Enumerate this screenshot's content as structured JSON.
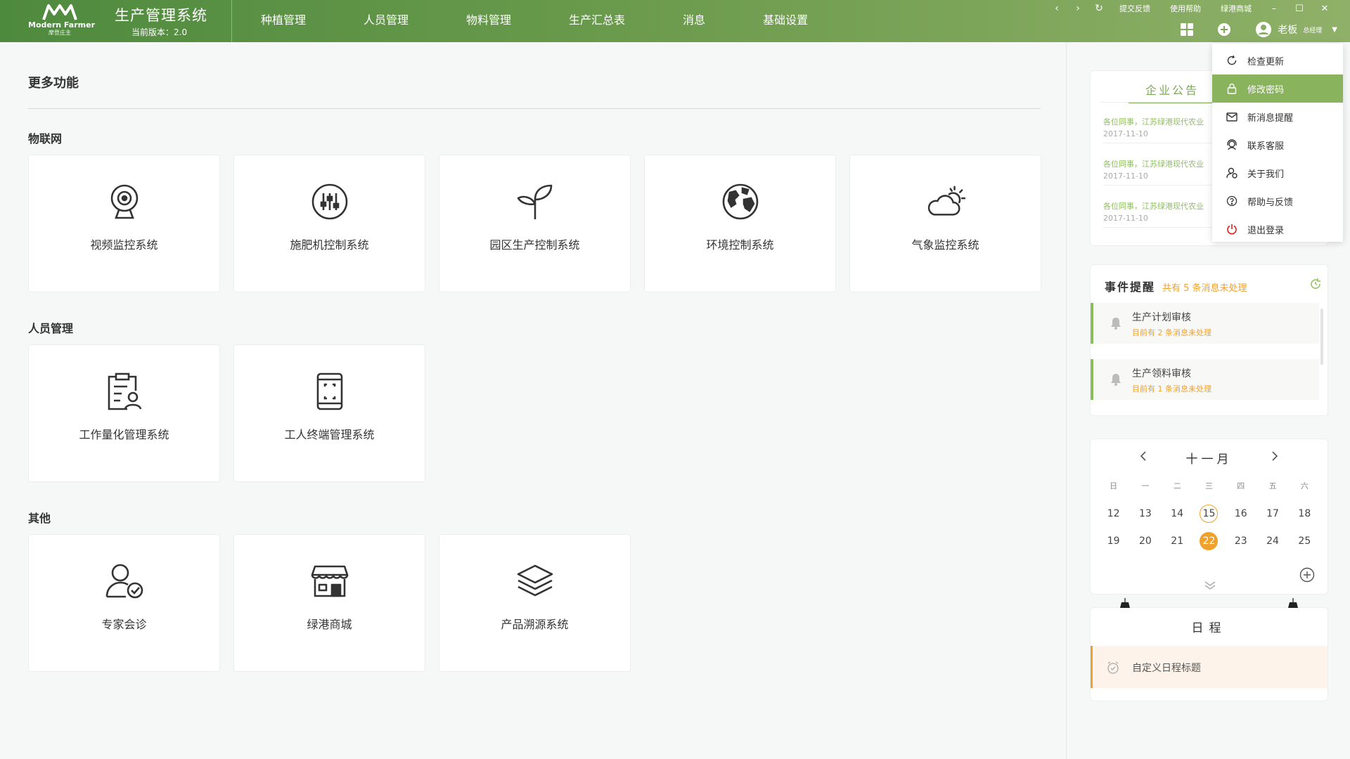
{
  "brand": {
    "logo_en": "Modern Farmer",
    "logo_cn": "摩登庄主",
    "app_title": "生产管理系统",
    "version": "当前版本：2.0"
  },
  "nav": [
    {
      "label": "种植管理"
    },
    {
      "label": "人员管理"
    },
    {
      "label": "物料管理"
    },
    {
      "label": "生产汇总表"
    },
    {
      "label": "消息"
    },
    {
      "label": "基础设置"
    }
  ],
  "toplinks": {
    "feedback": "提交反馈",
    "help": "使用帮助",
    "mall": "绿港商城"
  },
  "user": {
    "name": "老板",
    "role": "总经理"
  },
  "main": {
    "title": "更多功能",
    "sections": [
      {
        "title": "物联网",
        "cards": [
          {
            "label": "视频监控系统",
            "icon": "webcam-icon"
          },
          {
            "label": "施肥机控制系统",
            "icon": "sliders-icon"
          },
          {
            "label": "园区生产控制系统",
            "icon": "sprout-icon"
          },
          {
            "label": "环境控制系统",
            "icon": "globe-icon"
          },
          {
            "label": "气象监控系统",
            "icon": "weather-icon"
          }
        ]
      },
      {
        "title": "人员管理",
        "cards": [
          {
            "label": "工作量化管理系统",
            "icon": "clipboard-user-icon"
          },
          {
            "label": "工人终端管理系统",
            "icon": "mobile-terminal-icon"
          }
        ]
      },
      {
        "title": "其他",
        "cards": [
          {
            "label": "专家会诊",
            "icon": "expert-check-icon"
          },
          {
            "label": "绿港商城",
            "icon": "store-icon"
          },
          {
            "label": "产品溯源系统",
            "icon": "layers-icon"
          }
        ]
      }
    ]
  },
  "notice": {
    "tab": "企业公告",
    "items": [
      {
        "text": "各位同事，江苏绿港现代农业",
        "date": "2017-11-10"
      },
      {
        "text": "各位同事，江苏绿港现代农业",
        "date": "2017-11-10"
      },
      {
        "text": "各位同事，江苏绿港现代农业",
        "date": "2017-11-10"
      }
    ]
  },
  "events": {
    "title": "事件提醒",
    "subtitle": "共有 5 条消息未处理",
    "items": [
      {
        "title": "生产计划审核",
        "sub": "目前有  2  条消息未处理"
      },
      {
        "title": "生产领料审核",
        "sub": "目前有  1  条消息未处理"
      }
    ]
  },
  "calendar": {
    "month": "十一月",
    "weekdays": [
      "日",
      "一",
      "二",
      "三",
      "四",
      "五",
      "六"
    ],
    "week1": [
      "12",
      "13",
      "14",
      "15",
      "16",
      "17",
      "18"
    ],
    "week2": [
      "19",
      "20",
      "21",
      "22",
      "23",
      "24",
      "25"
    ],
    "ring_day": "15",
    "selected_day": "22"
  },
  "schedule": {
    "title": "日程",
    "item": "自定义日程标题"
  },
  "dropdown": [
    {
      "label": "检查更新",
      "icon": "refresh-icon"
    },
    {
      "label": "修改密码",
      "icon": "lock-icon",
      "active": true
    },
    {
      "label": "新消息提醒",
      "icon": "mail-icon"
    },
    {
      "label": "联系客服",
      "icon": "headset-icon"
    },
    {
      "label": "关于我们",
      "icon": "about-user-icon"
    },
    {
      "label": "帮助与反馈",
      "icon": "help-icon"
    },
    {
      "label": "退出登录",
      "icon": "power-icon"
    }
  ],
  "colors": {
    "brand_green": "#6a9a4c",
    "accent_orange": "#f0a12c",
    "notice_green": "#8fbf60"
  }
}
